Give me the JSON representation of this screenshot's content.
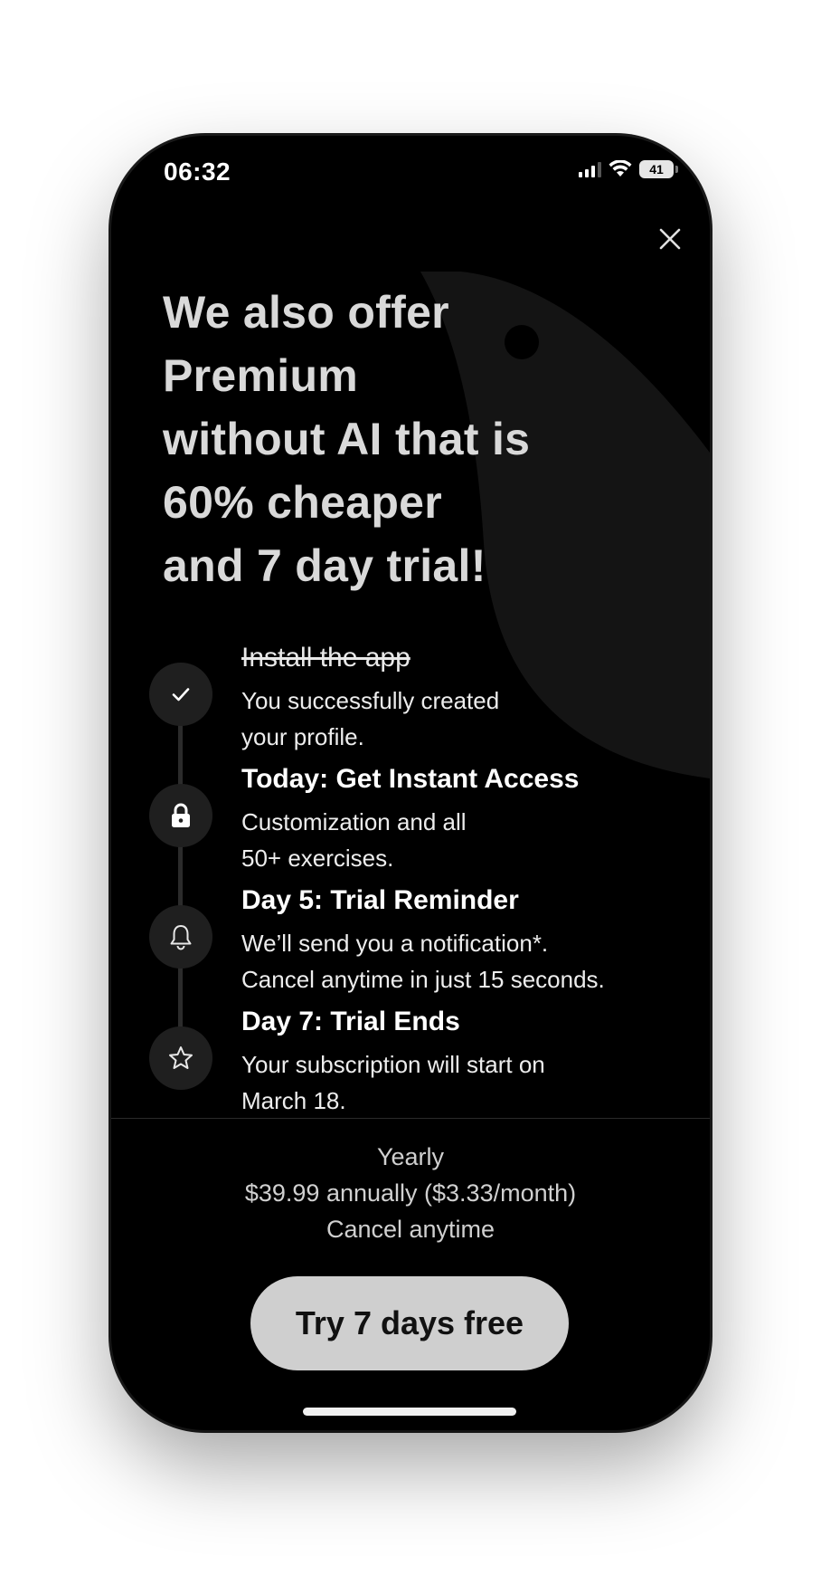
{
  "status_bar": {
    "time": "06:32",
    "battery": "41"
  },
  "headline": [
    "We also offer",
    "Premium",
    "without AI that is",
    "60% cheaper",
    "and 7 day trial!"
  ],
  "timeline": [
    {
      "icon": "checkmark-icon",
      "title": "Install the app",
      "desc": [
        "You successfully created",
        "your profile."
      ],
      "completed": true
    },
    {
      "icon": "lock-icon",
      "title": "Today: Get Instant Access",
      "desc": [
        "Customization and all",
        "50+ exercises."
      ],
      "completed": false
    },
    {
      "icon": "bell-icon",
      "title": "Day 5: Trial Reminder",
      "desc": [
        "We’ll send you a notification*.",
        "Cancel anytime in just 15 seconds."
      ],
      "completed": false
    },
    {
      "icon": "star-icon",
      "title": "Day 7: Trial Ends",
      "desc": [
        "Your subscription will start on",
        "March 18."
      ],
      "completed": false
    }
  ],
  "plan": {
    "name": "Yearly",
    "price": "$39.99 annually ($3.33/month)",
    "note": "Cancel anytime"
  },
  "cta": {
    "label": "Try 7 days free"
  },
  "colors": {
    "background": "#000000",
    "headline": "#d9d9d9",
    "button": "#cfcfcf",
    "icon_circle": "#1f1f1f"
  }
}
